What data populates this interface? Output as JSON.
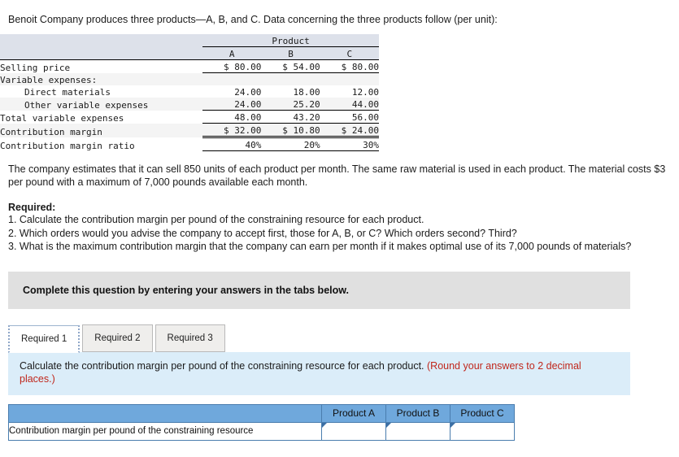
{
  "intro": "Benoit Company produces three products—A, B, and C. Data concerning the three products follow (per unit):",
  "given_table": {
    "group_header": "Product",
    "columns": [
      "A",
      "B",
      "C"
    ],
    "rows": [
      {
        "label": "Selling price",
        "values": [
          "$ 80.00",
          "$ 54.00",
          "$ 80.00"
        ]
      },
      {
        "label": "Variable expenses:",
        "values": [
          "",
          "",
          ""
        ]
      },
      {
        "label": "Direct materials",
        "values": [
          "24.00",
          "18.00",
          "12.00"
        ]
      },
      {
        "label": "Other variable expenses",
        "values": [
          "24.00",
          "25.20",
          "44.00"
        ]
      },
      {
        "label": "Total variable expenses",
        "values": [
          "48.00",
          "43.20",
          "56.00"
        ]
      },
      {
        "label": "Contribution margin",
        "values": [
          "$ 32.00",
          "$ 10.80",
          "$ 24.00"
        ]
      },
      {
        "label": "Contribution margin ratio",
        "values": [
          "40%",
          "20%",
          "30%"
        ]
      }
    ]
  },
  "body_paragraph": "The company estimates that it can sell 850 units of each product per month. The same raw material is used in each product. The material costs $3 per pound with a maximum of 7,000 pounds available each month.",
  "required": {
    "heading": "Required:",
    "items": [
      "1. Calculate the contribution margin per pound of the constraining resource for each product.",
      "2. Which orders would you advise the company to accept first, those for A, B, or C? Which orders second? Third?",
      "3. What is the maximum contribution margin that the company can earn per month if it makes optimal use of its 7,000 pounds of materials?"
    ]
  },
  "complete_banner": "Complete this question by entering your answers in the tabs below.",
  "tabs": [
    {
      "label": "Required 1",
      "active": true
    },
    {
      "label": "Required 2",
      "active": false
    },
    {
      "label": "Required 3",
      "active": false
    }
  ],
  "instruction": {
    "main": "Calculate the contribution margin per pound of the constraining resource for each product.",
    "hint": "(Round your answers to 2 decimal places.)"
  },
  "answer_table": {
    "headers": [
      "",
      "Product A",
      "Product B",
      "Product C"
    ],
    "row_label": "Contribution margin per pound of the constraining resource",
    "values": [
      "",
      "",
      ""
    ]
  },
  "colors": {
    "header_blue": "#6fa8dc",
    "panel_blue": "#dbedf9",
    "banner_gray": "#e0e0e0",
    "table_header_band": "#dde1ea",
    "hint_red": "#c0271c"
  }
}
